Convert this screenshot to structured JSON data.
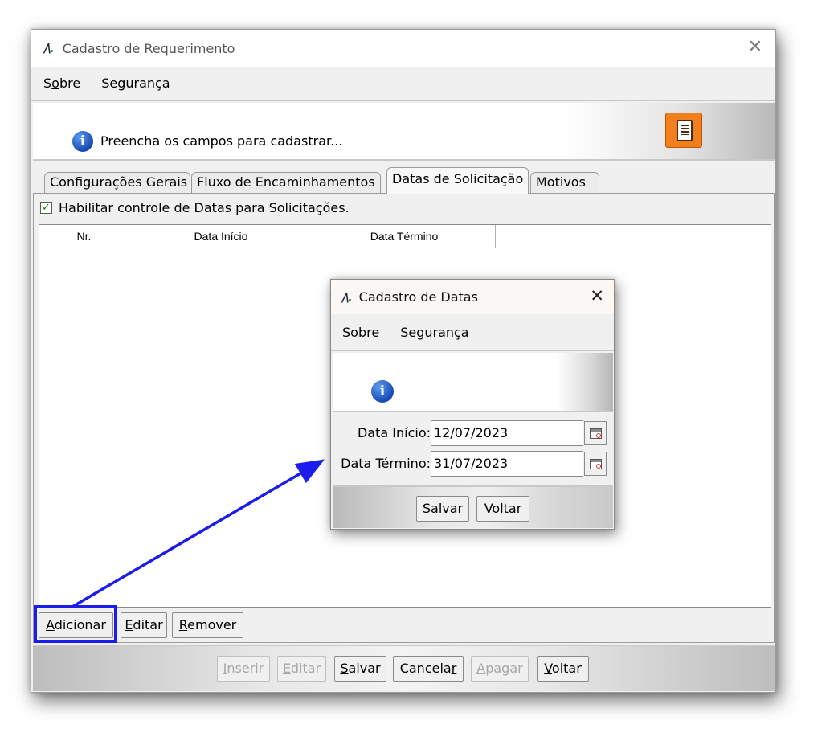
{
  "main_window": {
    "title": "Cadastro de Requerimento",
    "menu": [
      {
        "pre": "S",
        "ul": "o",
        "post": "bre"
      },
      {
        "pre": "",
        "ul": "",
        "post": "Segurança"
      }
    ],
    "header_text": "Preencha os campos para cadastrar...",
    "tabs": [
      "Configurações Gerais",
      "Fluxo de Encaminhamentos",
      "Datas de Solicitação",
      "Motivos"
    ],
    "active_tab": "Datas de Solicitação",
    "checkbox_label": "Habilitar controle de Datas para Solicitações.",
    "checkbox_checked": true,
    "grid_columns": [
      "Nr.",
      "Data Início",
      "Data Término"
    ],
    "grid_buttons": [
      {
        "ul": "A",
        "rest": "dicionar"
      },
      {
        "ul": "E",
        "rest": "ditar"
      },
      {
        "ul": "R",
        "rest": "emover"
      }
    ],
    "footer_buttons": [
      {
        "ul": "I",
        "rest": "nserir",
        "enabled": false
      },
      {
        "ul": "E",
        "rest": "ditar",
        "enabled": false
      },
      {
        "ul": "S",
        "rest": "alvar",
        "enabled": true
      },
      {
        "ul": "",
        "pre": "Cancela",
        "ul2": "r",
        "rest": "",
        "enabled": true
      },
      {
        "ul": "A",
        "rest": "pagar",
        "enabled": false
      },
      {
        "ul": "V",
        "rest": "oltar",
        "enabled": true
      }
    ]
  },
  "dialog": {
    "title": "Cadastro de Datas",
    "menu": [
      {
        "pre": "S",
        "ul": "o",
        "post": "bre"
      },
      {
        "pre": "",
        "ul": "",
        "post": "Segurança"
      }
    ],
    "data_inicio_label": "Data Início:",
    "data_inicio_value": "12/07/2023",
    "data_termino_label": "Data Término:",
    "data_termino_value": "31/07/2023",
    "buttons": [
      {
        "ul": "S",
        "rest": "alvar"
      },
      {
        "ul": "V",
        "rest": "oltar"
      }
    ]
  },
  "colors": {
    "highlight": "#1b1bee",
    "accent_orange": "#f07f1c",
    "check_green": "#1e7d24"
  },
  "icons": [
    "app-logo-icon",
    "info-icon",
    "document-icon",
    "calendar-icon",
    "close-icon"
  ]
}
